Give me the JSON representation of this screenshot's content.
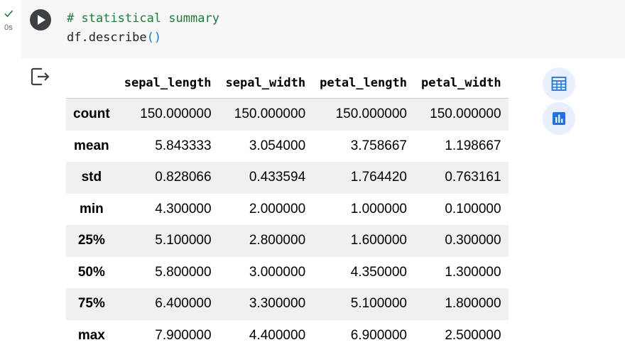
{
  "cell": {
    "status_icon": "check-icon",
    "exec_time": "0s",
    "run_icon": "play-icon",
    "code": {
      "line1": "# statistical summary",
      "line2_prefix": "df.describe",
      "line2_parens": "()"
    }
  },
  "output": {
    "icon": "output-redirect-icon",
    "columns": [
      "sepal_length",
      "sepal_width",
      "petal_length",
      "petal_width"
    ],
    "rows": [
      {
        "label": "count",
        "values": [
          "150.000000",
          "150.000000",
          "150.000000",
          "150.000000"
        ]
      },
      {
        "label": "mean",
        "values": [
          "5.843333",
          "3.054000",
          "3.758667",
          "1.198667"
        ]
      },
      {
        "label": "std",
        "values": [
          "0.828066",
          "0.433594",
          "1.764420",
          "0.763161"
        ]
      },
      {
        "label": "min",
        "values": [
          "4.300000",
          "2.000000",
          "1.000000",
          "0.100000"
        ]
      },
      {
        "label": "25%",
        "values": [
          "5.100000",
          "2.800000",
          "1.600000",
          "0.300000"
        ]
      },
      {
        "label": "50%",
        "values": [
          "5.800000",
          "3.000000",
          "4.350000",
          "1.300000"
        ]
      },
      {
        "label": "75%",
        "values": [
          "6.400000",
          "3.300000",
          "5.100000",
          "1.800000"
        ]
      },
      {
        "label": "max",
        "values": [
          "7.900000",
          "4.400000",
          "6.900000",
          "2.500000"
        ]
      }
    ],
    "shaded_rows": [
      0,
      2,
      4,
      6
    ]
  },
  "side_buttons": {
    "table_icon": "table-icon",
    "chart_icon": "bar-chart-icon",
    "accent": "#1a73e8",
    "background": "#e8f0fe"
  }
}
